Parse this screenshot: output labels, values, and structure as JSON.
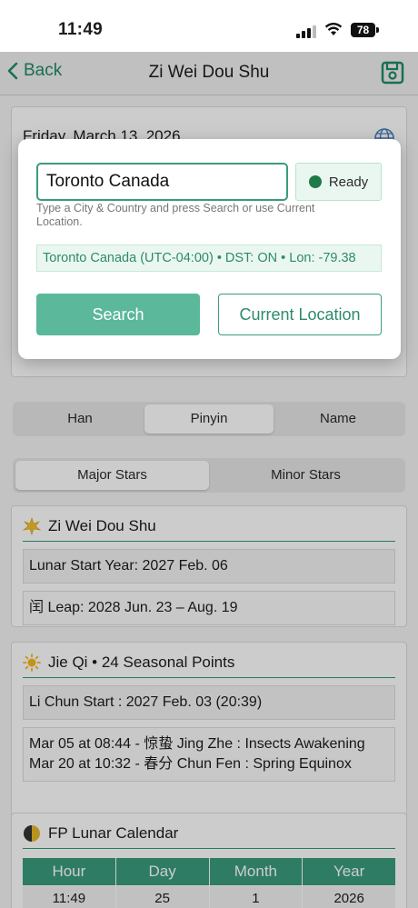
{
  "status_bar": {
    "time": "11:49",
    "battery": "78"
  },
  "nav": {
    "back_label": "Back",
    "title": "Zi Wei Dou Shu"
  },
  "date_card": {
    "date": "Friday, March 13, 2026"
  },
  "segments_name": {
    "items": [
      "Han",
      "Pinyin",
      "Name"
    ],
    "selected": "Pinyin"
  },
  "segments_stars": {
    "items": [
      "Major Stars",
      "Minor Stars"
    ],
    "selected": "Major Stars"
  },
  "zwds_card": {
    "title": "Zi Wei Dou Shu",
    "lunar_start": "Lunar Start Year: 2027 Feb. 06",
    "leap": "闰 Leap: 2028 Jun. 23 – Aug. 19"
  },
  "jieqi_card": {
    "title": "Jie Qi • 24 Seasonal Points",
    "li_chun": "Li Chun Start : 2027 Feb. 03 (20:39)",
    "term1": "Mar 05 at 08:44 - 惊蛰 Jing Zhe : Insects Awakening",
    "term2": "Mar 20 at 10:32 - 春分 Chun Fen : Spring Equinox"
  },
  "lunar_card": {
    "title": "FP Lunar Calendar",
    "headers": [
      "Hour",
      "Day",
      "Month",
      "Year"
    ],
    "values": [
      "11:49",
      "25",
      "1",
      "2026"
    ]
  },
  "modal": {
    "city_value": "Toronto Canada",
    "status": "Ready",
    "hint": "Type a City & Country and press Search or use Current Location.",
    "timezone_info": "Toronto Canada (UTC-04:00) • DST: ON • Lon: -79.38",
    "search_label": "Search",
    "current_location_label": "Current Location"
  },
  "colors": {
    "accent": "#3a9c7c",
    "button": "#5bb89a",
    "ready_dot": "#1f7a4a"
  }
}
